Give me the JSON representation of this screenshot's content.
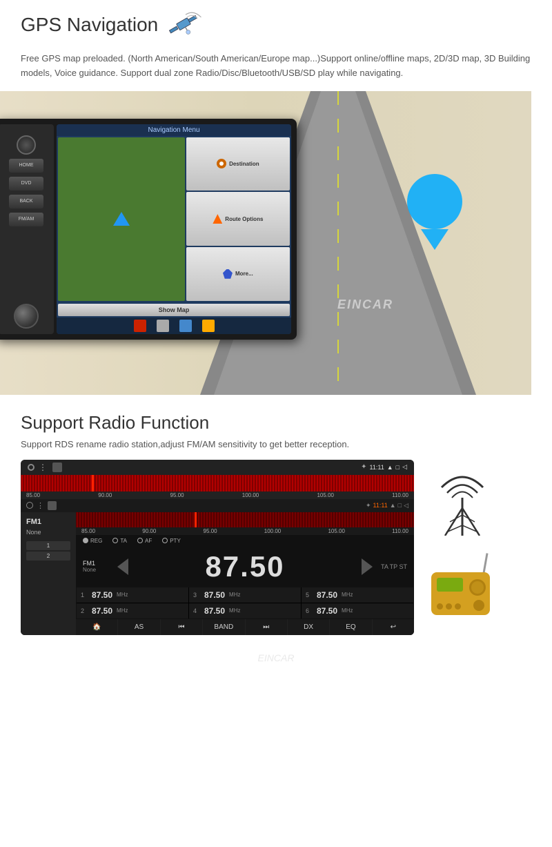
{
  "gps": {
    "title": "GPS Navigation",
    "description": "Free GPS map preloaded. (North American/South American/Europe map...)Support\nonline/offline maps, 2D/3D map, 3D Building models, Voice guidance.\nSupport dual zone Radio/Disc/Bluetooth/USB/SD play while navigating.",
    "nav_title": "Navigation Menu",
    "btn_destination": "Destination",
    "btn_route": "Route Options",
    "btn_more": "More...",
    "btn_show_map": "Show Map",
    "radio_btns": [
      "HOME",
      "DVD",
      "BACK",
      "FM/AM"
    ]
  },
  "radio": {
    "title": "Support Radio Function",
    "description": "Support RDS rename radio station,adjust FM/AM sensitivity to get better reception.",
    "status_time": "11:11",
    "freq_labels": [
      "85.00",
      "90.00",
      "95.00",
      "100.00",
      "105.00",
      "110.00"
    ],
    "fm_mode": "FM1",
    "fm_station": "None",
    "big_freq": "87.50",
    "options": [
      "REG",
      "TA",
      "AF",
      "PTY"
    ],
    "ta_tp_st": "TA TP ST",
    "presets": [
      {
        "num": "1",
        "freq": "87.50",
        "unit": "MHz"
      },
      {
        "num": "3",
        "freq": "87.50",
        "unit": "MHz"
      },
      {
        "num": "5",
        "freq": "87.50",
        "unit": "MHz"
      },
      {
        "num": "2",
        "freq": "87.50",
        "unit": "MHz"
      },
      {
        "num": "4",
        "freq": "87.50",
        "unit": "MHz"
      },
      {
        "num": "6",
        "freq": "87.50",
        "unit": "MHz"
      }
    ],
    "control_btns": [
      "🏠",
      "AS",
      "⏮",
      "BAND",
      "⏭",
      "DX",
      "EQ",
      "↩"
    ]
  },
  "watermark": "EINCAR"
}
